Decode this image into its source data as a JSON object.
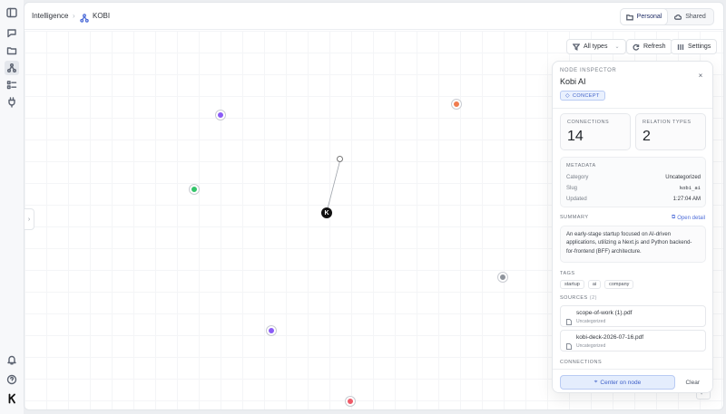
{
  "breadcrumb": {
    "root": "Intelligence",
    "current": "KOBI"
  },
  "scope": {
    "personal": "Personal",
    "shared": "Shared"
  },
  "toolbar": {
    "filter": "All types",
    "refresh": "Refresh",
    "settings": "Settings"
  },
  "graph": {
    "nodes": [
      {
        "id": "kobi-ai",
        "label": "K",
        "color": "#111111"
      },
      {
        "id": "n-purple-1",
        "color": "#8b5cf6"
      },
      {
        "id": "n-orange",
        "color": "#f07c4f"
      },
      {
        "id": "n-green",
        "color": "#34c46a"
      },
      {
        "id": "n-gray",
        "color": "#8f949c"
      },
      {
        "id": "n-purple-2",
        "color": "#8b5cf6"
      },
      {
        "id": "n-red",
        "color": "#ee5a68"
      },
      {
        "id": "n-source",
        "color": "#ffffff"
      }
    ]
  },
  "inspector": {
    "eyebrow": "NODE INSPECTOR",
    "title": "Kobi AI",
    "close": "×",
    "badge": "CONCEPT",
    "stats": [
      {
        "label": "CONNECTIONS",
        "value": "14"
      },
      {
        "label": "RELATION TYPES",
        "value": "2"
      }
    ],
    "metadata": {
      "heading": "METADATA",
      "rows": [
        {
          "key": "Category",
          "value": "Uncategorized"
        },
        {
          "key": "Slug",
          "value": "kobi_ai"
        },
        {
          "key": "Updated",
          "value": "1:27:04 AM"
        }
      ]
    },
    "summary": {
      "heading": "SUMMARY",
      "link": "Open detail",
      "text": "An early-stage startup focused on AI-driven applications, utilizing a Next.js and Python backend-for-frontend (BFF) architecture."
    },
    "tags": {
      "heading": "TAGS",
      "items": [
        "startup",
        "ai",
        "company"
      ]
    },
    "sources": {
      "heading": "SOURCES",
      "count": "(2)",
      "items": [
        {
          "name": "scope-of-work (1).pdf",
          "category": "Uncategorized"
        },
        {
          "name": "kobi-deck-2026-07-16.pdf",
          "category": "Uncategorized"
        }
      ]
    },
    "connections_heading": "CONNECTIONS",
    "center_button": "Center on node",
    "clear_button": "Clear"
  },
  "accent": "#4d6cd8"
}
